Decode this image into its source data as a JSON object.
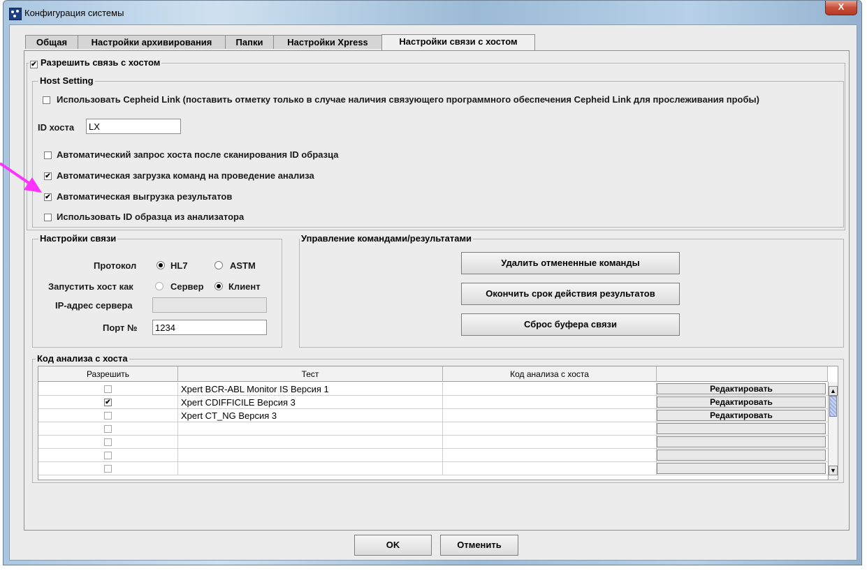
{
  "window": {
    "title": "Конфигурация системы",
    "close_label": "X"
  },
  "tabs": [
    {
      "label": "Общая"
    },
    {
      "label": "Настройки архивирования"
    },
    {
      "label": "Папки"
    },
    {
      "label": "Настройки Xpress"
    },
    {
      "label": "Настройки связи с хостом"
    }
  ],
  "enable_host": {
    "label": "Разрешить связь с хостом",
    "checked": true
  },
  "host_setting": {
    "legend": "Host Setting",
    "cepheid_link": {
      "label": "Использовать Cepheid Link (поставить отметку только в случае наличия связующего программного обеспечения Cepheid Link для прослеживания пробы)",
      "checked": false
    },
    "host_id_label": "ID хоста",
    "host_id_value": "LX",
    "options": [
      {
        "label": "Автоматический запрос хоста после сканирования ID образца",
        "checked": false
      },
      {
        "label": "Автоматическая загрузка команд на проведение анализа",
        "checked": true
      },
      {
        "label": "Автоматическая выгрузка результатов",
        "checked": true
      },
      {
        "label": "Использовать ID образца из анализатора",
        "checked": false
      }
    ]
  },
  "comm_settings": {
    "legend": "Настройки связи",
    "protocol_label": "Протокол",
    "protocol_hl7": "HL7",
    "protocol_astm": "ASTM",
    "protocol_selected": "HL7",
    "run_as_label": "Запустить хост как",
    "run_as_server": "Сервер",
    "run_as_client": "Клиент",
    "run_as_selected": "Клиент",
    "ip_label": "IP-адрес сервера",
    "ip_value": "",
    "port_label": "Порт №",
    "port_value": "1234"
  },
  "order_mgmt": {
    "legend": "Управление командами/результатами",
    "delete_cancelled": "Удалить отмененные команды",
    "expire_results": "Окончить срок действия результатов",
    "reset_buffer": "Сброс буфера связи"
  },
  "host_test_code": {
    "legend": "Код анализа с хоста",
    "columns": [
      "Разрешить",
      "Тест",
      "Код анализа с хоста",
      ""
    ],
    "edit_label": "Редактировать",
    "rows": [
      {
        "checked": false,
        "test": "Xpert BCR-ABL Monitor IS Версия 1",
        "code": "",
        "has_edit": true
      },
      {
        "checked": true,
        "test": "Xpert CDIFFICILE Версия 3",
        "code": "",
        "has_edit": true
      },
      {
        "checked": false,
        "test": "Xpert CT_NG Версия 3",
        "code": "",
        "has_edit": true
      },
      {
        "checked": false,
        "test": "",
        "code": "",
        "has_edit": false
      },
      {
        "checked": false,
        "test": "",
        "code": "",
        "has_edit": false
      },
      {
        "checked": false,
        "test": "",
        "code": "",
        "has_edit": false
      },
      {
        "checked": false,
        "test": "",
        "code": "",
        "has_edit": false
      }
    ]
  },
  "footer": {
    "ok": "OK",
    "cancel": "Отменить"
  },
  "colors": {
    "annotation_arrow": "#ff33ff",
    "close_button": "#c7503a"
  }
}
